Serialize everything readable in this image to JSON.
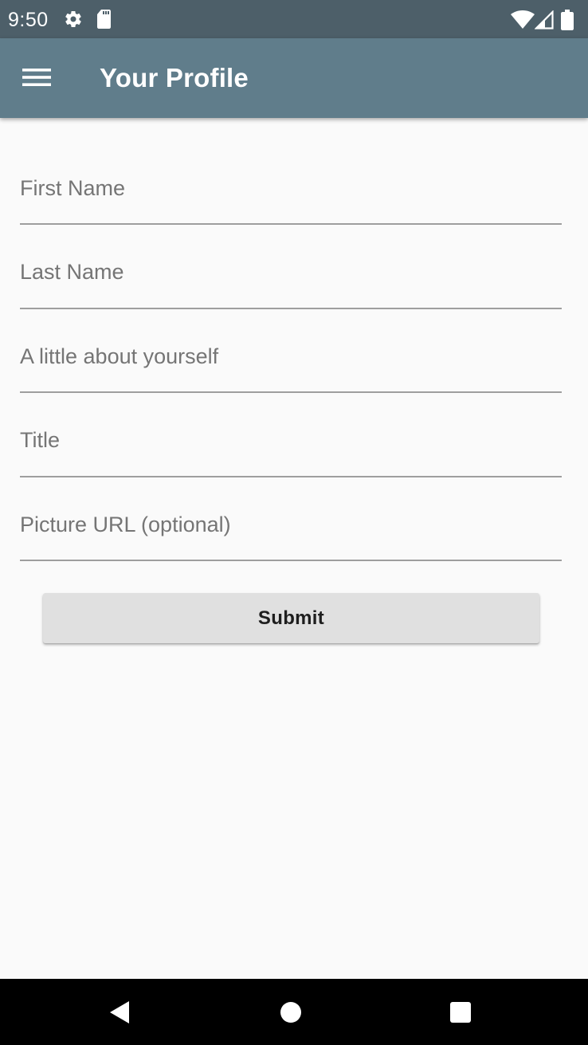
{
  "status_bar": {
    "time": "9:50",
    "icons": [
      "gear-icon",
      "sd-card-icon",
      "wifi-icon",
      "signal-icon",
      "battery-icon"
    ]
  },
  "app_bar": {
    "title": "Your Profile",
    "menu_icon": "hamburger-menu-icon",
    "background_color": "#607d8b"
  },
  "form": {
    "fields": [
      {
        "placeholder": "First Name",
        "value": ""
      },
      {
        "placeholder": "Last Name",
        "value": ""
      },
      {
        "placeholder": "A little about yourself",
        "value": ""
      },
      {
        "placeholder": "Title",
        "value": ""
      },
      {
        "placeholder": "Picture URL (optional)",
        "value": ""
      }
    ],
    "submit_label": "Submit"
  },
  "nav_bar": {
    "icons": [
      "back-icon",
      "home-icon",
      "recents-icon"
    ]
  },
  "colors": {
    "status_bar": "#4d5f69",
    "app_bar": "#607d8b",
    "background": "#fafafa",
    "button": "#e0e0e0"
  }
}
